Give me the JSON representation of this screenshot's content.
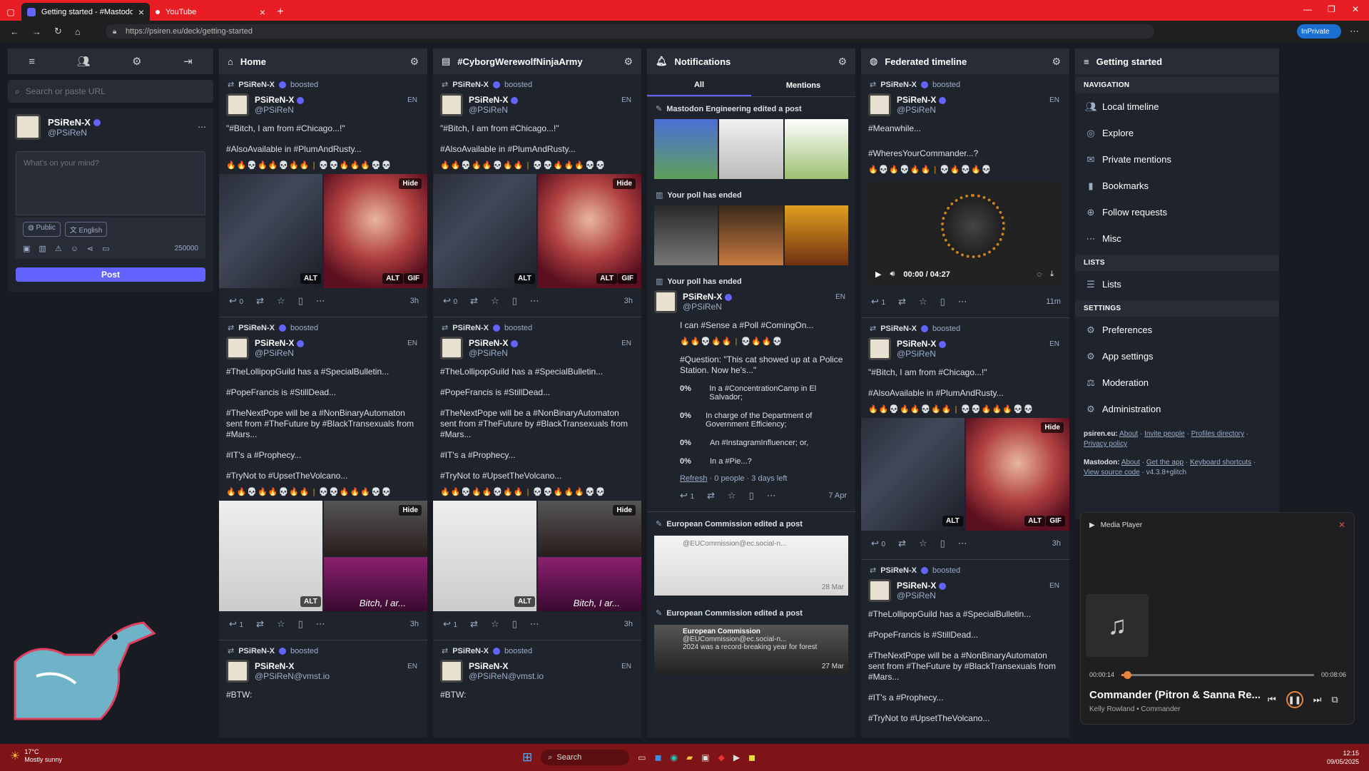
{
  "browser": {
    "tabs": [
      {
        "title": "Getting started - #MastodonSpyf",
        "active": true
      },
      {
        "title": "YouTube",
        "active": false
      }
    ],
    "url": "https://psiren.eu/deck/getting-started",
    "inprivate_label": "InPrivate"
  },
  "sidebar": {
    "search_placeholder": "Search or paste URL",
    "profile": {
      "name": "PSiReN-X",
      "handle": "@PSiReN"
    },
    "compose_placeholder": "What's on your mind?",
    "visibility": "Public",
    "language": "English",
    "char_count": "250000",
    "post_label": "Post"
  },
  "columns": {
    "home": {
      "title": "Home",
      "posts": [
        {
          "boost": "PSiReN-X",
          "boost_label": "boosted",
          "name": "PSiReN-X",
          "handle": "@PSiReN",
          "lang": "EN",
          "text1": "\"#Bitch, I am from #Chicago...!\"",
          "text2": "#AlsoAvailable in #PlumAndRusty...",
          "replies": "0",
          "time": "3h"
        },
        {
          "boost": "PSiReN-X",
          "boost_label": "boosted",
          "name": "PSiReN-X",
          "handle": "@PSiReN",
          "lang": "EN",
          "text1": "#TheLollipopGuild has a #SpecialBulletin...",
          "text2": "#PopeFrancis is #StillDead...",
          "text3": "#TheNextPope will be a #NonBinaryAutomaton sent from #TheFuture by #BlackTransexuals from #Mars...",
          "text4": "#IT's a #Prophecy...",
          "text5": "#TryNot to #UpsetTheVolcano...",
          "replies": "1",
          "time": "3h",
          "caption": "Bitch, I ar..."
        },
        {
          "boost": "PSiReN-X",
          "boost_label": "boosted",
          "name": "PSiReN-X",
          "handle": "@PSiReN@vmst.io",
          "lang": "EN",
          "text1": "#BTW:"
        }
      ]
    },
    "hashtag": {
      "title": "#CyborgWerewolfNinjaArmy"
    },
    "notifications": {
      "title": "Notifications",
      "tab_all": "All",
      "tab_mentions": "Mentions",
      "n1": "Mastodon Engineering edited a post",
      "n2": "Your poll has ended",
      "n3": "Your poll has ended",
      "post": {
        "name": "PSiReN-X",
        "handle": "@PSiReN",
        "lang": "EN",
        "text1": "I can #Sense a #Poll #ComingOn...",
        "question": "#Question: \"This cat showed up at a Police Station. Now he's...\"",
        "options": [
          {
            "pct": "0%",
            "label": "In a #ConcentrationCamp in El Salvador;"
          },
          {
            "pct": "0%",
            "label": "In charge of the Department of Government Efficiency;"
          },
          {
            "pct": "0%",
            "label": "An #InstagramInfluencer; or,"
          },
          {
            "pct": "0%",
            "label": "In a #Pie...?"
          }
        ],
        "refresh": "Refresh",
        "meta": "· 0 people · 3 days left",
        "replies": "1",
        "time": "7 Apr"
      },
      "n4": "European Commission edited a post",
      "n4_handle": "@EUCommission@ec.social-n...",
      "n4_date": "28 Mar",
      "n5": "European Commission edited a post",
      "n5_name": "European Commission",
      "n5_handle": "@EUCommission@ec.social-n...",
      "n5_text": "2024 was a record-breaking year for forest",
      "n5_date": "27 Mar"
    },
    "federated": {
      "title": "Federated timeline",
      "p1": {
        "boost": "PSiReN-X",
        "boost_label": "boosted",
        "name": "PSiReN-X",
        "handle": "@PSiReN",
        "lang": "EN",
        "text1": "#Meanwhile...",
        "text2": "#WheresYourCommander...?",
        "audio_time": "00:00 / 04:27",
        "replies": "1",
        "time": "11m"
      },
      "p2": {
        "boost": "PSiReN-X",
        "boost_label": "boosted",
        "name": "PSiReN-X",
        "handle": "@PSiReN",
        "lang": "EN",
        "text1": "\"#Bitch, I am from #Chicago...!\"",
        "text2": "#AlsoAvailable in #PlumAndRusty...",
        "replies": "0",
        "time": "3h"
      },
      "p3": {
        "boost": "PSiReN-X",
        "boost_label": "boosted",
        "name": "PSiReN-X",
        "handle": "@PSiReN",
        "lang": "EN",
        "text1": "#TheLollipopGuild has a #SpecialBulletin...",
        "text2": "#PopeFrancis is #StillDead...",
        "text3": "#TheNextPope will be a #NonBinaryAutomaton sent from #TheFuture by #BlackTransexuals from #Mars...",
        "text4": "#IT's a #Prophecy...",
        "text5": "#TryNot to #UpsetTheVolcano..."
      }
    },
    "getting_started": {
      "title": "Getting started",
      "nav_label": "NAVIGATION",
      "nav": [
        "Local timeline",
        "Explore",
        "Private mentions",
        "Bookmarks",
        "Follow requests",
        "Misc"
      ],
      "lists_label": "LISTS",
      "lists": [
        "Lists"
      ],
      "settings_label": "SETTINGS",
      "settings": [
        "Preferences",
        "App settings",
        "Moderation",
        "Administration"
      ],
      "footer1_site": "psiren.eu:",
      "footer1_links": [
        "About",
        "Invite people",
        "Profiles directory",
        "Privacy policy"
      ],
      "footer2_site": "Mastodon:",
      "footer2_links": [
        "About",
        "Get the app",
        "Keyboard shortcuts",
        "View source code"
      ],
      "version": "v4.3.8+glitch"
    }
  },
  "common": {
    "hide": "Hide",
    "alt": "ALT",
    "gif": "GIF"
  },
  "media_player": {
    "title": "Media Player",
    "elapsed": "00:00:14",
    "duration": "00:08:06",
    "progress": 0.029,
    "track": "Commander (Pitron & Sanna Re...",
    "artist": "Kelly Rowland • Commander"
  },
  "taskbar": {
    "weather_temp": "17°C",
    "weather_desc": "Mostly sunny",
    "search": "Search",
    "time": "12:15",
    "date": "09/05/2025"
  }
}
